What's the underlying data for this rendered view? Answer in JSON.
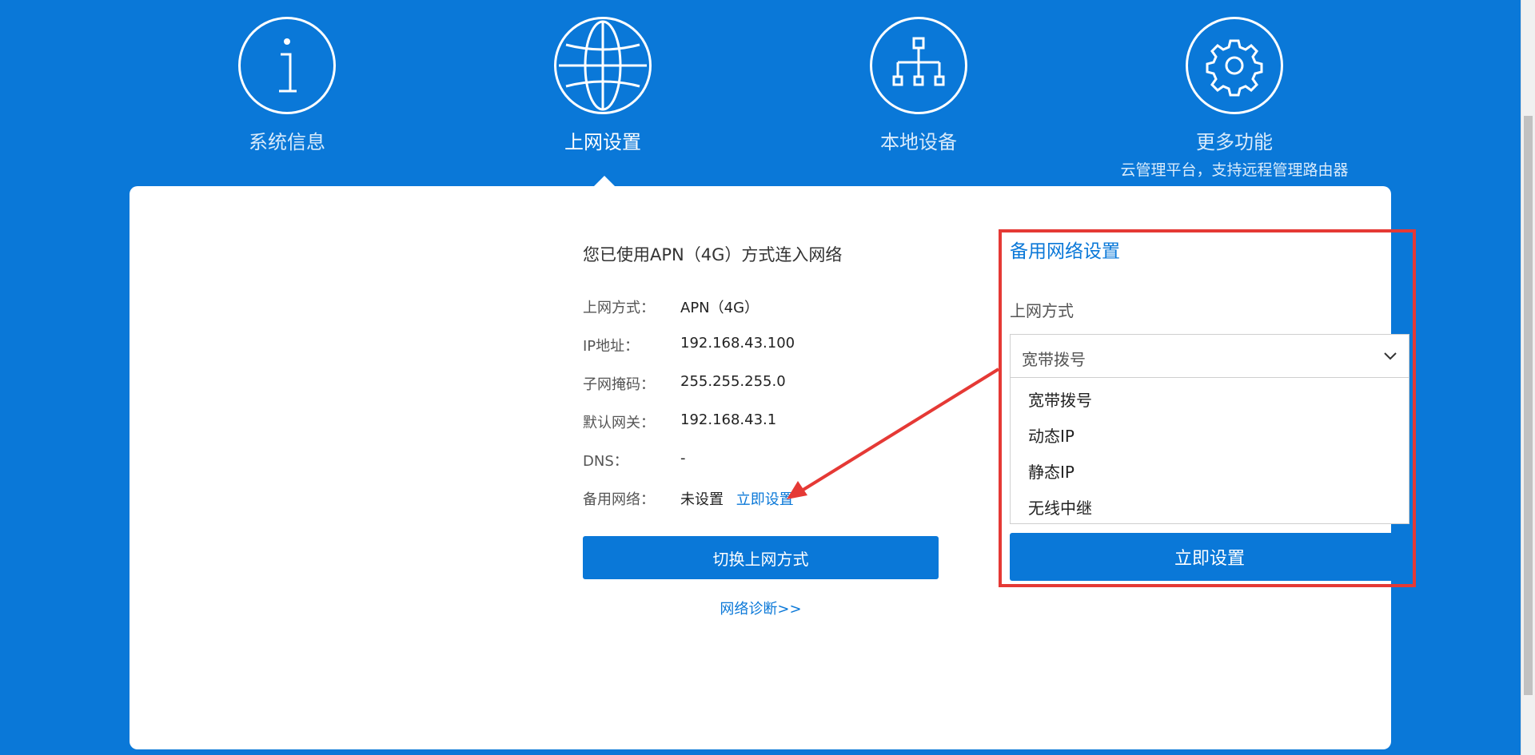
{
  "nav": {
    "items": [
      {
        "label": "系统信息",
        "icon": "info-icon"
      },
      {
        "label": "上网设置",
        "icon": "globe-icon"
      },
      {
        "label": "本地设备",
        "icon": "network-tree-icon"
      },
      {
        "label": "更多功能",
        "sublabel": "云管理平台，支持远程管理路由器",
        "icon": "gear-icon"
      }
    ],
    "active_index": 1
  },
  "status": {
    "title": "您已使用APN（4G）方式连入网络",
    "rows": [
      {
        "label": "上网方式：",
        "value": "APN（4G）"
      },
      {
        "label": "IP地址：",
        "value": "192.168.43.100"
      },
      {
        "label": "子网掩码：",
        "value": "255.255.255.0"
      },
      {
        "label": "默认网关：",
        "value": "192.168.43.1"
      },
      {
        "label": "DNS：",
        "value": "-"
      },
      {
        "label": "备用网络：",
        "value": "未设置",
        "link": "立即设置"
      }
    ],
    "switch_button": "切换上网方式",
    "diagnose_link": "网络诊断>>"
  },
  "backup_panel": {
    "title": "备用网络设置",
    "field_label": "上网方式",
    "selected": "宽带拨号",
    "options": [
      "宽带拨号",
      "动态IP",
      "静态IP",
      "无线中继"
    ],
    "apply_button": "立即设置"
  },
  "colors": {
    "brand": "#0a78d8",
    "annotation": "#e53935"
  }
}
